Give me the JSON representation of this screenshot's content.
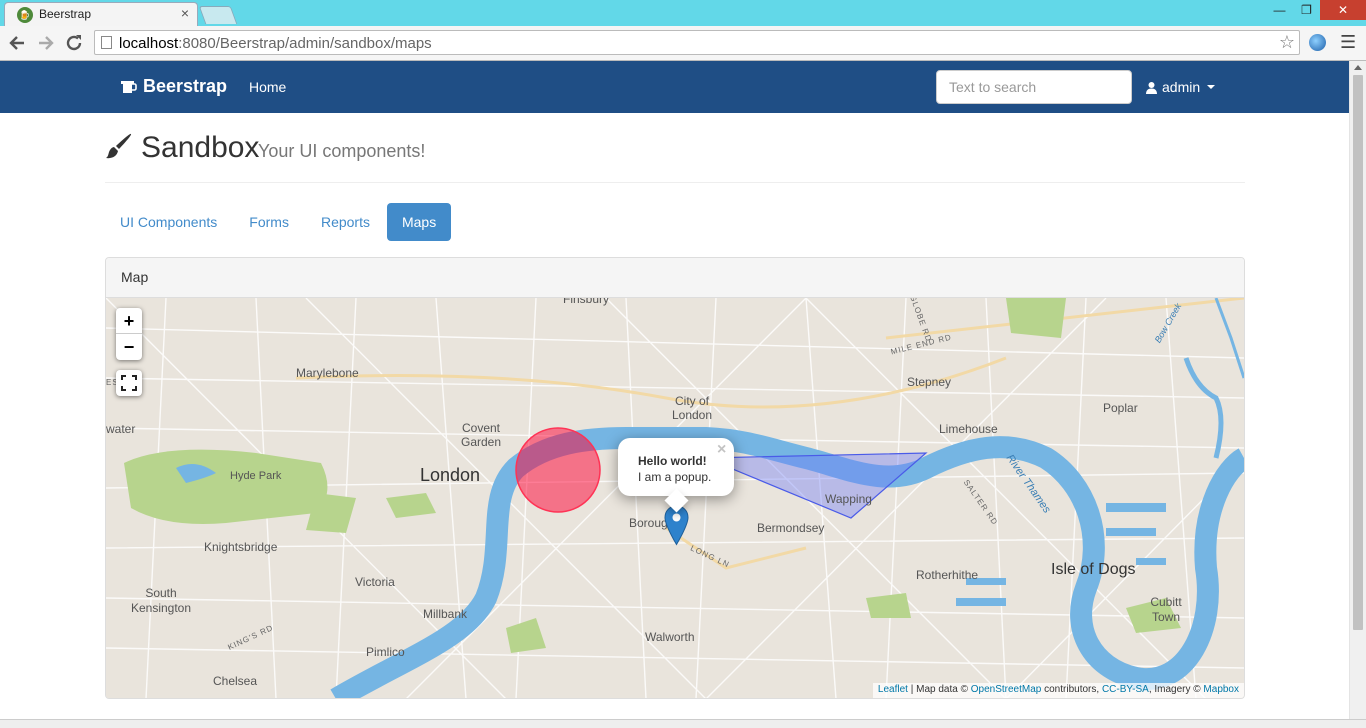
{
  "browser": {
    "tab_title": "Beerstrap",
    "tab_close": "×",
    "url_host": "localhost",
    "url_path": ":8080/Beerstrap/admin/sandbox/maps",
    "window_buttons": {
      "minimize": "—",
      "restore": "❐",
      "close": "✕"
    }
  },
  "navbar": {
    "brand": "Beerstrap",
    "home": "Home",
    "search_placeholder": "Text to search",
    "user": "admin"
  },
  "header": {
    "title": "Sandbox",
    "subtitle": "Your UI components!"
  },
  "pills": [
    {
      "label": "UI Components",
      "active": false
    },
    {
      "label": "Forms",
      "active": false
    },
    {
      "label": "Reports",
      "active": false
    },
    {
      "label": "Maps",
      "active": true
    }
  ],
  "panel": {
    "heading": "Map"
  },
  "map": {
    "zoom_in": "+",
    "zoom_out": "−",
    "labels": {
      "finsbury": "Finsbury",
      "marylebone": "Marylebone",
      "city_of_london": "City of\nLondon",
      "covent_garden": "Covent\nGarden",
      "water": "water",
      "estwr": "ESTWR",
      "hyde_park": "Hyde Park",
      "london": "London",
      "knightsbridge": "Knightsbridge",
      "south_kensington": "South\nKensington",
      "victoria": "Victoria",
      "millbank": "Millbank",
      "pimlico": "Pimlico",
      "chelsea": "Chelsea",
      "kings_rd": "KING'S RD",
      "borough": "Borough",
      "long_ln": "LONG LN",
      "walworth": "Walworth",
      "bermondsey": "Bermondsey",
      "wapping": "Wapping",
      "rotherhithe": "Rotherhithe",
      "isle_of_dogs": "Isle of Dogs",
      "cubitt_town": "Cubitt\nTown",
      "limehouse": "Limehouse",
      "poplar": "Poplar",
      "stepney": "Stepney",
      "mile_end_rd": "MILE END RD",
      "globe_rd": "GLOBE RD",
      "salter_rd": "SALTER RD",
      "river_thames": "River Thames",
      "bow_creek": "Bow Creek"
    },
    "popup": {
      "title": "Hello world!",
      "text": "I am a popup.",
      "close": "×"
    },
    "attribution": {
      "leaflet": "Leaflet",
      "sep": " | Map data © ",
      "osm": "OpenStreetMap",
      "contributors": " contributors, ",
      "license": "CC-BY-SA",
      "imagery": ", Imagery © ",
      "mapbox": "Mapbox"
    },
    "colors": {
      "water": "#75b5e3",
      "park": "#b7d48d",
      "land": "#e9e4dc",
      "circle": "#f03",
      "polygon": "#6f7bf7"
    }
  }
}
